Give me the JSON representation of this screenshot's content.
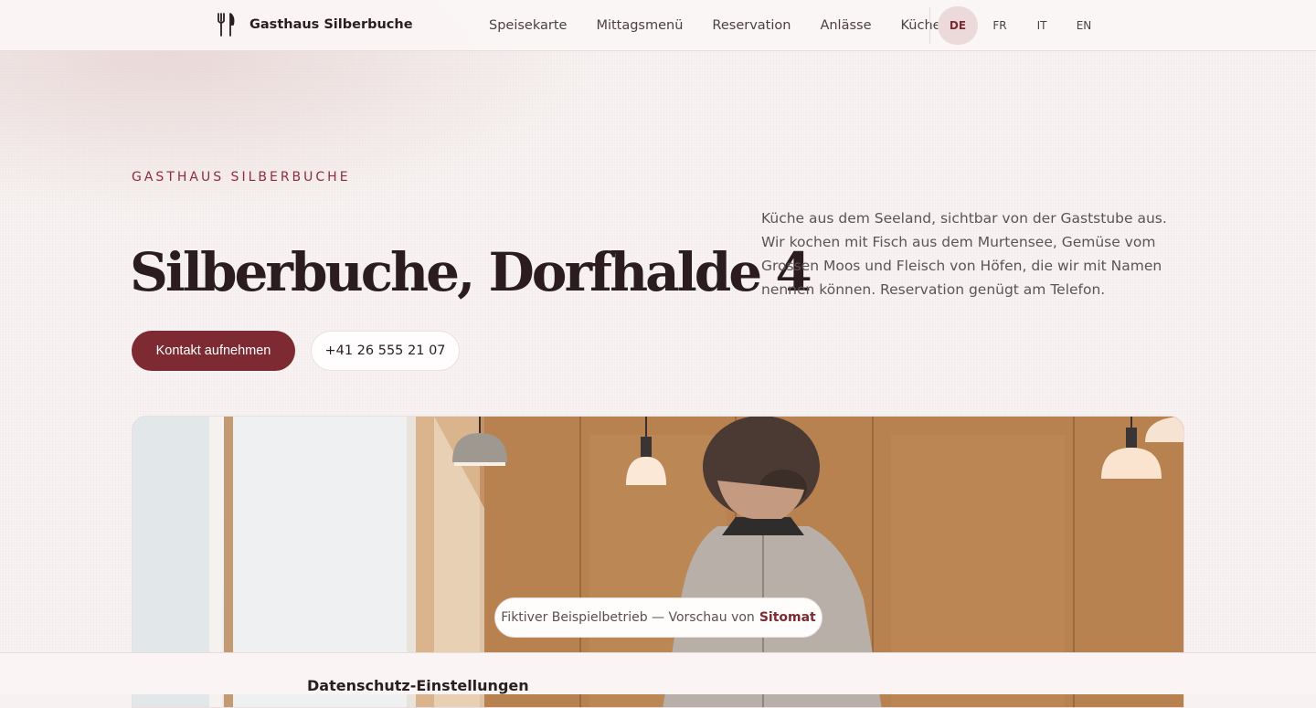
{
  "nav": {
    "brand_name": "Gasthaus Silberbuche",
    "links": [
      "Speisekarte",
      "Mittagsmenü",
      "Reservation",
      "Anlässe",
      "Küche"
    ],
    "languages": [
      "DE",
      "FR",
      "IT",
      "EN"
    ],
    "active_language": "DE"
  },
  "hero": {
    "eyebrow": "GASTHAUS SILBERBUCHE",
    "headline": "Silberbuche, Dorfhalde 4",
    "intro": "Küche aus dem Seeland, sichtbar von der Gaststube aus. Wir kochen mit Fisch aus dem Murtensee, Gemüse vom Grossen Moos und Fleisch von Höfen, die wir mit Namen nennen können. Reservation genügt am Telefon.",
    "primary_button": "Kontakt aufnehmen",
    "phone_button": "+41 26 555 21 07"
  },
  "badge": {
    "text": "Fiktiver Beispielbetrieb — Vorschau von",
    "link": "Sitomat"
  },
  "consent": {
    "title": "Datenschutz-Einstellungen"
  },
  "colors": {
    "accent": "#7d2a33",
    "eyebrow": "#8c2e38",
    "background": "#f8f3f2"
  },
  "icons": {
    "brand": "fork-knife-icon"
  }
}
